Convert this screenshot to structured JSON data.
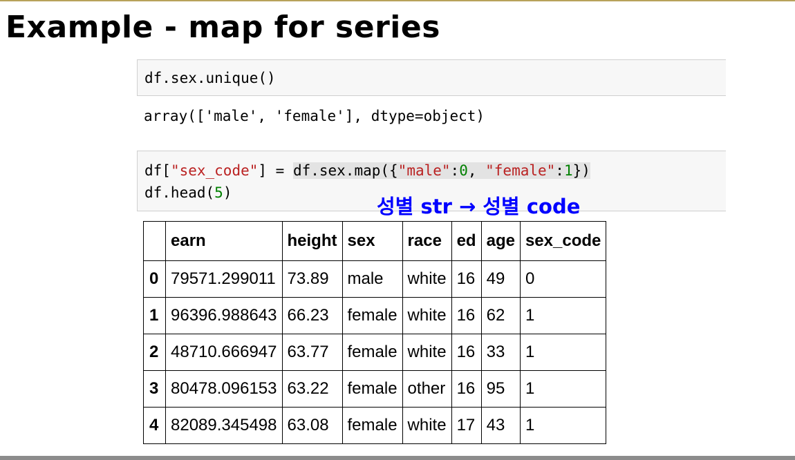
{
  "slide": {
    "title": "Example - map for series"
  },
  "cell1": {
    "code": "df.sex.unique()"
  },
  "output1": {
    "text": "array(['male', 'female'], dtype=object)"
  },
  "cell2": {
    "line1": {
      "p1": "df[",
      "s1": "\"sex_code\"",
      "p2": "] = ",
      "h1": "df.sex.map({",
      "s2": "\"male\"",
      "p3": ":",
      "n1": "0",
      "p4": ", ",
      "s3": "\"female\"",
      "p5": ":",
      "n2": "1",
      "p6": "})"
    },
    "line2": {
      "p1": "df.head(",
      "n1": "5",
      "p2": ")"
    }
  },
  "annotation": {
    "text": "성별 str → 성별 code",
    "color": "#0000ff"
  },
  "table": {
    "columns": [
      "",
      "earn",
      "height",
      "sex",
      "race",
      "ed",
      "age",
      "sex_code"
    ],
    "rows": [
      [
        "0",
        "79571.299011",
        "73.89",
        "male",
        "white",
        "16",
        "49",
        "0"
      ],
      [
        "1",
        "96396.988643",
        "66.23",
        "female",
        "white",
        "16",
        "62",
        "1"
      ],
      [
        "2",
        "48710.666947",
        "63.77",
        "female",
        "white",
        "16",
        "33",
        "1"
      ],
      [
        "3",
        "80478.096153",
        "63.22",
        "female",
        "other",
        "16",
        "95",
        "1"
      ],
      [
        "4",
        "82089.345498",
        "63.08",
        "female",
        "white",
        "17",
        "43",
        "1"
      ]
    ]
  }
}
